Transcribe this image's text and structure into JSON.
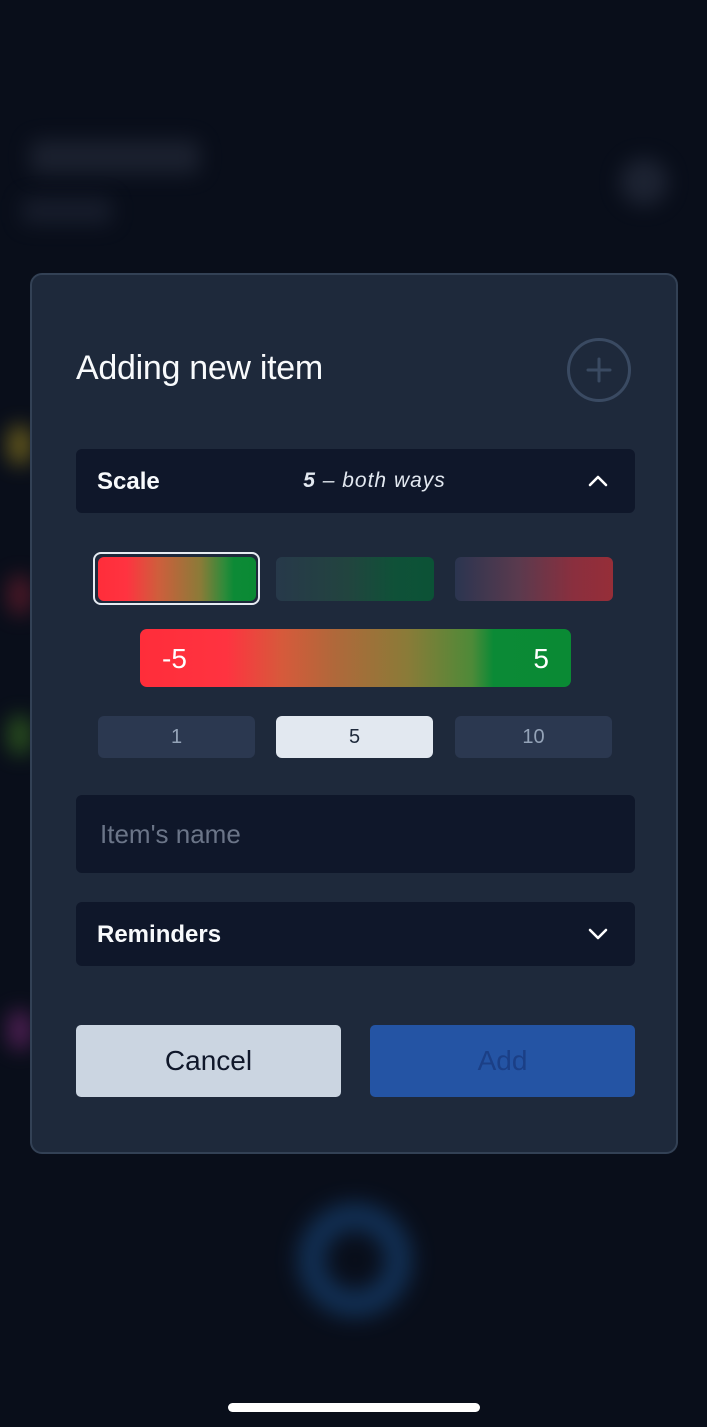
{
  "modal": {
    "title": "Adding new item",
    "scale_accordion": {
      "label": "Scale",
      "value_number": "5",
      "value_text": " – both ways",
      "expanded": true
    },
    "color_schemes": [
      {
        "name": "red-to-green",
        "selected": true
      },
      {
        "name": "neutral-to-green",
        "selected": false
      },
      {
        "name": "neutral-to-red",
        "selected": false
      }
    ],
    "range_preview": {
      "min": "-5",
      "max": "5"
    },
    "scale_options": [
      {
        "label": "1",
        "selected": false
      },
      {
        "label": "5",
        "selected": true
      },
      {
        "label": "10",
        "selected": false
      }
    ],
    "name_input": {
      "value": "",
      "placeholder": "Item's name"
    },
    "reminders_accordion": {
      "label": "Reminders",
      "expanded": false
    },
    "buttons": {
      "cancel": "Cancel",
      "add": "Add"
    }
  },
  "colors": {
    "modal_bg": "#1e293b",
    "field_bg": "#0f172a",
    "accent_blue": "#2454a4",
    "red": "#ff2d3a",
    "green": "#0a8a34"
  }
}
